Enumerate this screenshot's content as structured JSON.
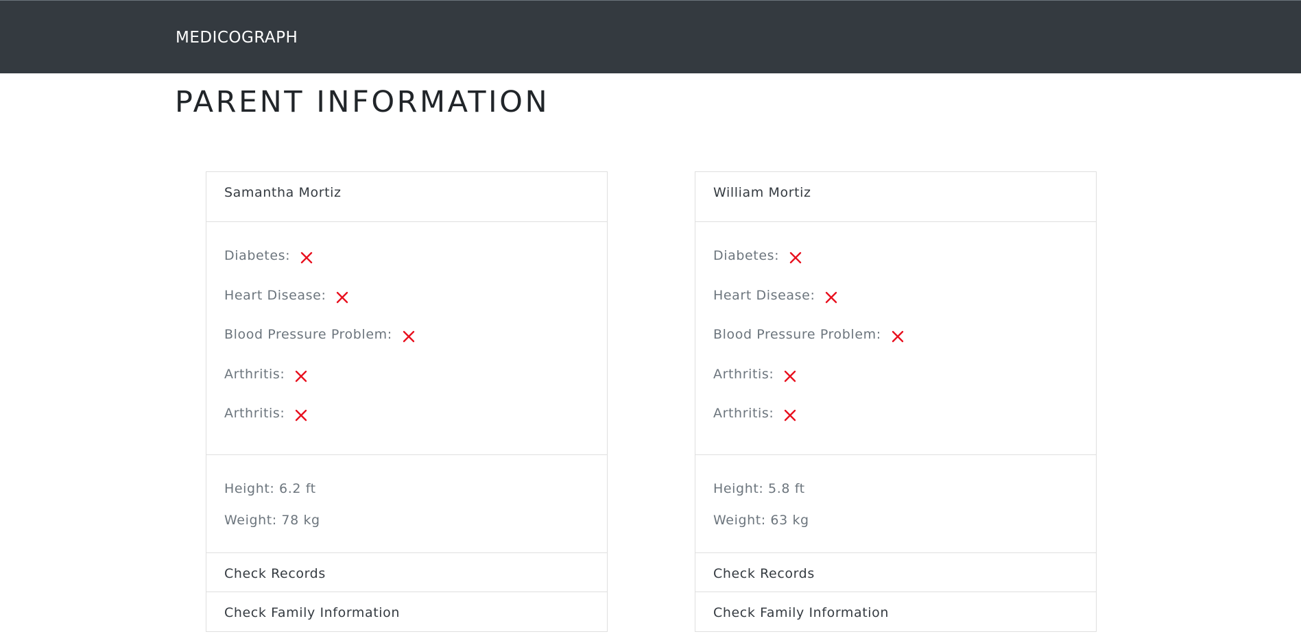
{
  "navbar": {
    "brand": "MEDICOGRAPH"
  },
  "page": {
    "title": "PARENT INFORMATION"
  },
  "parents": [
    {
      "name": "Samantha Mortiz",
      "conditions": [
        {
          "label": "Diabetes:",
          "status_icon": "cross-icon"
        },
        {
          "label": "Heart Disease:",
          "status_icon": "cross-icon"
        },
        {
          "label": "Blood Pressure Problem:",
          "status_icon": "cross-icon"
        },
        {
          "label": "Arthritis:",
          "status_icon": "cross-icon"
        },
        {
          "label": "Arthritis:",
          "status_icon": "cross-icon"
        }
      ],
      "height": "Height: 6.2 ft",
      "weight": "Weight: 78 kg",
      "links": {
        "records": "Check Records",
        "family": "Check Family Information"
      }
    },
    {
      "name": "William Mortiz",
      "conditions": [
        {
          "label": "Diabetes:",
          "status_icon": "cross-icon"
        },
        {
          "label": "Heart Disease:",
          "status_icon": "cross-icon"
        },
        {
          "label": "Blood Pressure Problem:",
          "status_icon": "cross-icon"
        },
        {
          "label": "Arthritis:",
          "status_icon": "cross-icon"
        },
        {
          "label": "Arthritis:",
          "status_icon": "cross-icon"
        }
      ],
      "height": "Height: 5.8 ft",
      "weight": "Weight: 63 kg",
      "links": {
        "records": "Check Records",
        "family": "Check Family Information"
      }
    }
  ],
  "colors": {
    "navbar_bg": "#343a40",
    "cross_icon": "#e8101e",
    "muted_text": "#6c757d",
    "border": "#dfdfdf"
  }
}
